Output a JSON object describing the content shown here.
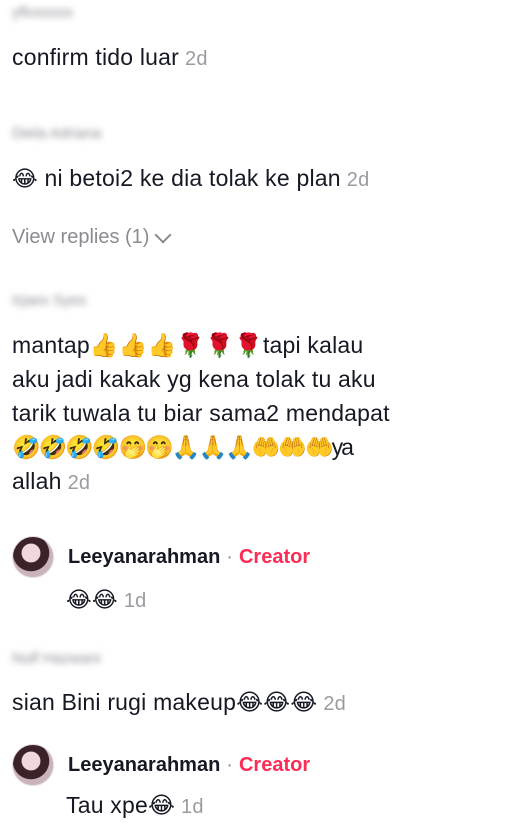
{
  "comments": [
    {
      "username": "yflosssss",
      "text": "confirm tido luar",
      "time": "2d"
    },
    {
      "username": "Diela Adriana",
      "text": "ni betoi2 ke dia tolak ke plan",
      "leading_emoji": "😂",
      "time": "2d",
      "view_replies": "View replies (1)"
    },
    {
      "username": "Irjaes Syes",
      "lines": [
        "mantap👍👍👍🌹🌹🌹tapi kalau",
        "aku jadi kakak yg kena tolak tu aku",
        "tarik tuwala tu biar sama2 mendapat",
        "🤣🤣🤣🤣🤭🤭🙏🙏🙏🤲🤲🤲ya",
        "allah"
      ],
      "time": "2d"
    },
    {
      "username": "Nulf Hazwani",
      "text": "sian Bini rugi makeup😂😂😂",
      "time": "2d"
    }
  ],
  "replies": [
    {
      "author": "Leeyanarahman",
      "separator": "·",
      "badge": "Creator",
      "text": "😂😂",
      "time": "1d"
    },
    {
      "author": "Leeyanarahman",
      "separator": "·",
      "badge": "Creator",
      "text": "Tau xpe😂",
      "time": "1d"
    }
  ],
  "icons": {
    "chevron": "chevron-down-icon",
    "avatar": "avatar"
  },
  "colors": {
    "creator_badge": "#fe2c55",
    "muted": "#8a8b91",
    "text": "#161823"
  }
}
